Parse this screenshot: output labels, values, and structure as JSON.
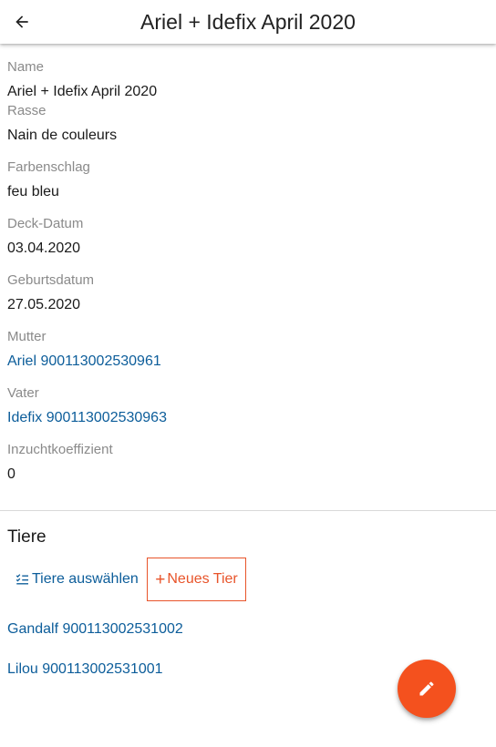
{
  "header": {
    "title": "Ariel + Idefix April 2020"
  },
  "fields": [
    {
      "label": "Name",
      "value": "Ariel + Idefix April 2020"
    },
    {
      "label": "Rasse",
      "value": "Nain de couleurs"
    },
    {
      "label": "Farbenschlag",
      "value": "feu bleu"
    },
    {
      "label": "Deck-Datum",
      "value": "03.04.2020"
    },
    {
      "label": "Geburtsdatum",
      "value": "27.05.2020"
    },
    {
      "label": "Mutter",
      "value": "Ariel 900113002530961"
    },
    {
      "label": "Vater",
      "value": "Idefix 900113002530963"
    },
    {
      "label": "Inzuchtkoeffizient",
      "value": "0"
    }
  ],
  "animals_section": {
    "title": "Tiere",
    "select_label": "Tiere auswählen",
    "new_label": "Neues Tier",
    "new_plus": "+",
    "items": [
      {
        "label": "Gandalf 900113002531002"
      },
      {
        "label": "Lilou 900113002531001"
      }
    ]
  },
  "colors": {
    "link": "#0c5d9a",
    "accent": "#f4511e",
    "label": "#8a8a8a"
  },
  "icons": {
    "back": "arrow-back-icon",
    "select": "checklist-icon",
    "fab": "pencil-icon"
  }
}
